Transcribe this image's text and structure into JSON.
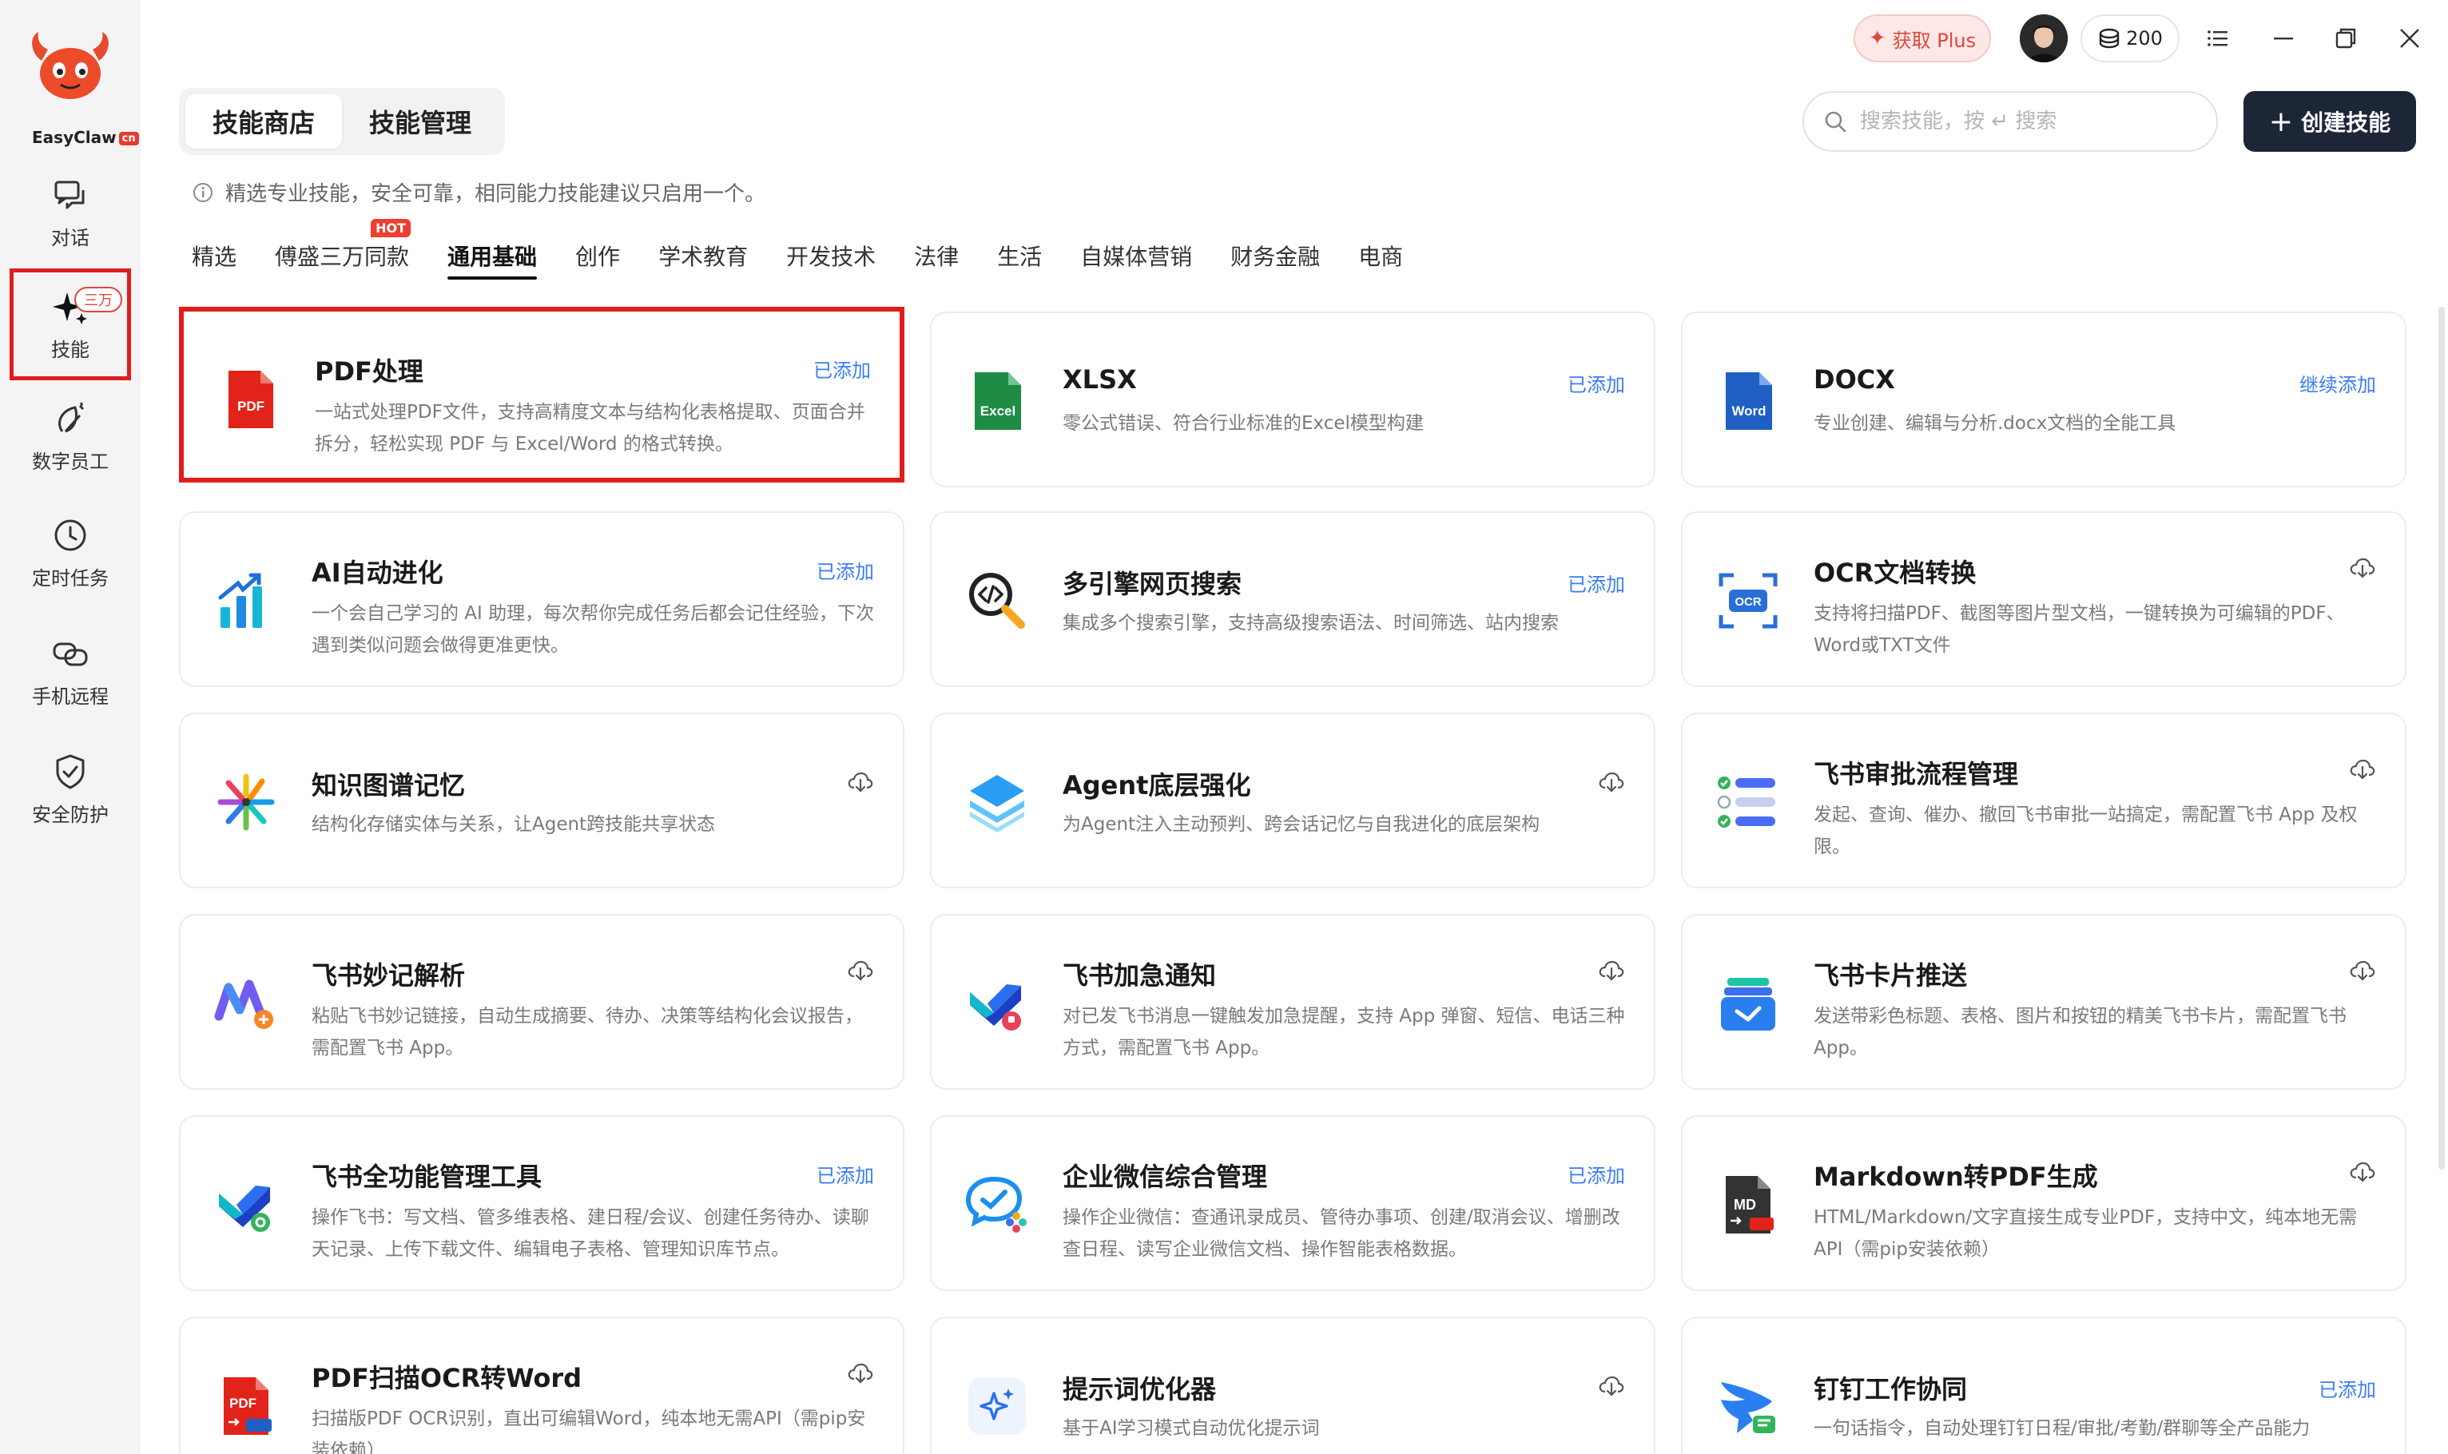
{
  "app": {
    "name": "EasyClaw",
    "name_badge": "cn"
  },
  "sidebar": {
    "items": [
      {
        "label": "对话",
        "icon": "chat-icon"
      },
      {
        "label": "技能",
        "icon": "sparkle-icon",
        "badge": "三万"
      },
      {
        "label": "数字员工",
        "icon": "digital-worker-icon"
      },
      {
        "label": "定时任务",
        "icon": "clock-icon"
      },
      {
        "label": "手机远程",
        "icon": "phone-remote-icon"
      },
      {
        "label": "安全防护",
        "icon": "shield-icon"
      }
    ]
  },
  "topbar": {
    "plus_label": "获取 Plus",
    "coins": "200"
  },
  "header": {
    "tabs": [
      {
        "label": "技能商店"
      },
      {
        "label": "技能管理"
      }
    ],
    "search_placeholder": "搜索技能，按 ↵ 搜索",
    "create_label": "创建技能",
    "notice": "精选专业技能，安全可靠，相同能力技能建议只启用一个。"
  },
  "categories": [
    {
      "label": "精选"
    },
    {
      "label": "傅盛三万同款",
      "hot": "HOT"
    },
    {
      "label": "通用基础"
    },
    {
      "label": "创作"
    },
    {
      "label": "学术教育"
    },
    {
      "label": "开发技术"
    },
    {
      "label": "法律"
    },
    {
      "label": "生活"
    },
    {
      "label": "自媒体营销"
    },
    {
      "label": "财务金融"
    },
    {
      "label": "电商"
    }
  ],
  "colors": {
    "accent_red": "#e21d1d",
    "added_blue": "#3b7cf7",
    "create_button": "#1d2636"
  },
  "cards": [
    {
      "title": "PDF处理",
      "desc": "一站式处理PDF文件，支持高精度文本与结构化表格提取、页面合并拆分，轻松实现 PDF 与 Excel/Word 的格式转换。",
      "status": "已添加",
      "icon": "pdf-icon",
      "icon_text": "PDF"
    },
    {
      "title": "XLSX",
      "desc": "零公式错误、符合行业标准的Excel模型构建",
      "status": "已添加",
      "icon": "excel-icon",
      "icon_text": "Excel"
    },
    {
      "title": "DOCX",
      "desc": "专业创建、编辑与分析.docx文档的全能工具",
      "status": "继续添加",
      "icon": "word-icon",
      "icon_text": "Word"
    },
    {
      "title": "AI自动进化",
      "desc": "一个会自己学习的 AI 助理，每次帮你完成任务后都会记住经验，下次遇到类似问题会做得更准更快。",
      "status": "已添加",
      "icon": "growth-chart-icon"
    },
    {
      "title": "多引擎网页搜索",
      "desc": "集成多个搜索引擎，支持高级搜索语法、时间筛选、站内搜索",
      "status": "已添加",
      "icon": "code-search-icon"
    },
    {
      "title": "OCR文档转换",
      "desc": "支持将扫描PDF、截图等图片型文档，一键转换为可编辑的PDF、Word或TXT文件",
      "status": "",
      "icon": "ocr-icon",
      "icon_text": "OCR"
    },
    {
      "title": "知识图谱记忆",
      "desc": "结构化存储实体与关系，让Agent跨技能共享状态",
      "status": "",
      "icon": "knowledge-graph-icon"
    },
    {
      "title": "Agent底层强化",
      "desc": "为Agent注入主动预判、跨会话记忆与自我进化的底层架构",
      "status": "",
      "icon": "layers-icon"
    },
    {
      "title": "飞书审批流程管理",
      "desc": "发起、查询、催办、撤回飞书审批一站搞定，需配置飞书 App 及权限。",
      "status": "",
      "icon": "approval-list-icon"
    },
    {
      "title": "飞书妙记解析",
      "desc": "粘贴飞书妙记链接，自动生成摘要、待办、决策等结构化会议报告，需配置飞书 App。",
      "status": "",
      "icon": "feishu-minutes-icon"
    },
    {
      "title": "飞书加急通知",
      "desc": "对已发飞书消息一键触发加急提醒，支持 App 弹窗、短信、电话三种方式，需配置飞书 App。",
      "status": "",
      "icon": "feishu-urgent-icon"
    },
    {
      "title": "飞书卡片推送",
      "desc": "发送带彩色标题、表格、图片和按钮的精美飞书卡片，需配置飞书 App。",
      "status": "",
      "icon": "feishu-card-icon"
    },
    {
      "title": "飞书全功能管理工具",
      "desc": "操作飞书：写文档、管多维表格、建日程/会议、创建任务待办、读聊天记录、上传下载文件、编辑电子表格、管理知识库节点。",
      "status": "已添加",
      "icon": "feishu-tools-icon"
    },
    {
      "title": "企业微信综合管理",
      "desc": "操作企业微信：查通讯录成员、管待办事项、创建/取消会议、增删改查日程、读写企业微信文档、操作智能表格数据。",
      "status": "已添加",
      "icon": "wecom-icon"
    },
    {
      "title": "Markdown转PDF生成",
      "desc": "HTML/Markdown/文字直接生成专业PDF，支持中文，纯本地无需API（需pip安装依赖）",
      "status": "",
      "icon": "markdown-pdf-icon",
      "icon_text": "MD"
    },
    {
      "title": "PDF扫描OCR转Word",
      "desc": "扫描版PDF OCR识别，直出可编辑Word，纯本地无需API（需pip安装依赖）",
      "status": "",
      "icon": "pdf-to-word-icon",
      "icon_text": "PDF"
    },
    {
      "title": "提示词优化器",
      "desc": "基于AI学习模式自动优化提示词",
      "status": "",
      "icon": "prompt-sparkle-icon"
    },
    {
      "title": "钉钉工作协同",
      "desc": "一句话指令，自动处理钉钉日程/审批/考勤/群聊等全产品能力",
      "status": "已添加",
      "icon": "dingtalk-icon"
    }
  ]
}
